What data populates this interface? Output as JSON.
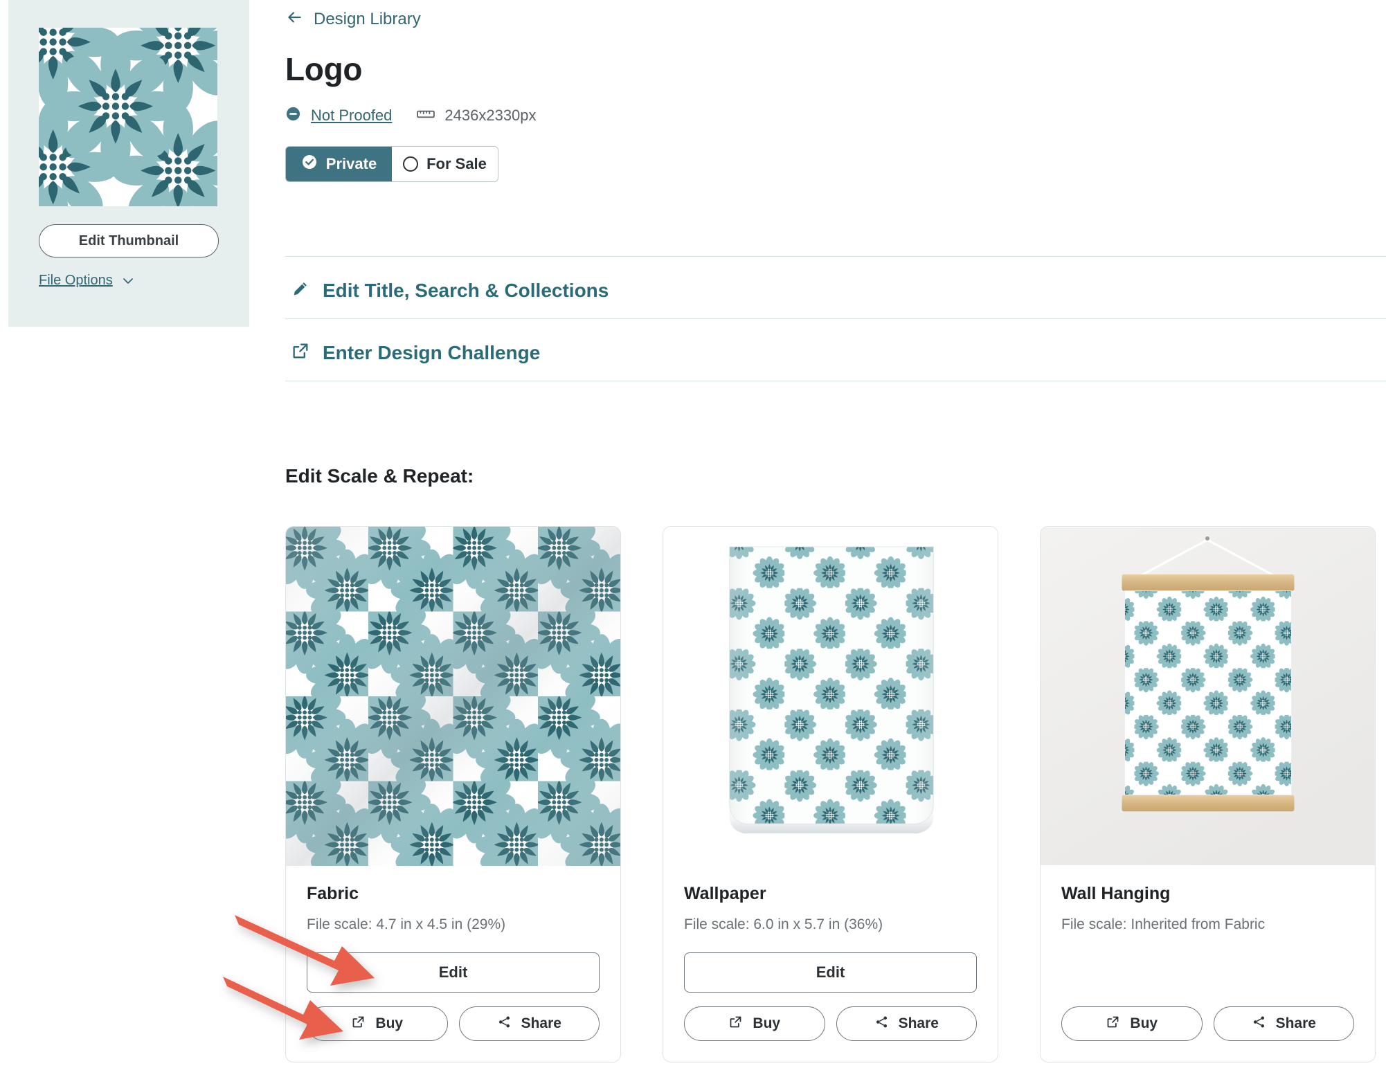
{
  "theme": {
    "teal": "#3f7381",
    "teal_link": "#336672",
    "teal_action": "#2b6b77",
    "sidebar_bg": "#e6eeee",
    "arrow_color": "#e8604c",
    "petal_light": "#8ebdc2",
    "petal_dark": "#2d6670",
    "divider": "#d7e0e3"
  },
  "sidebar": {
    "thumbnail_alt": "floral-pattern-thumbnail",
    "edit_thumbnail_label": "Edit Thumbnail",
    "file_options_label": "File Options",
    "chevron_icon": "chevron-down-icon"
  },
  "header": {
    "back_icon": "arrow-left-icon",
    "breadcrumb_label": "Design Library",
    "title": "Logo",
    "proof_icon": "minus-circle-icon",
    "proof_status": "Not Proofed",
    "ruler_icon": "ruler-icon",
    "dimensions": "2436x2330px",
    "toggle": {
      "private_label": "Private",
      "private_icon": "check-circle-icon",
      "for_sale_label": "For Sale",
      "for_sale_icon": "radio-empty-icon",
      "selected": "Private"
    }
  },
  "actions": [
    {
      "label": "Edit Title, Search & Collections",
      "icon": "pencil-icon"
    },
    {
      "label": "Enter Design Challenge",
      "icon": "external-link-icon"
    }
  ],
  "main": {
    "section_title": "Edit Scale & Repeat:"
  },
  "cards": [
    {
      "title": "Fabric",
      "scale": "File scale:  4.7 in x 4.5 in (29%)",
      "media": "fabric-swatch-image",
      "edit_label": "Edit",
      "has_edit": true,
      "buy_label": "Buy",
      "buy_icon": "external-link-icon",
      "share_label": "Share",
      "share_icon": "share-icon"
    },
    {
      "title": "Wallpaper",
      "scale": "File scale:  6.0 in x 5.7 in (36%)",
      "media": "wallpaper-roll-image",
      "edit_label": "Edit",
      "has_edit": true,
      "buy_label": "Buy",
      "buy_icon": "external-link-icon",
      "share_label": "Share",
      "share_icon": "share-icon"
    },
    {
      "title": "Wall Hanging",
      "scale": "File scale:  Inherited from Fabric",
      "media": "wall-hanging-image",
      "edit_label": "",
      "has_edit": false,
      "buy_label": "Buy",
      "buy_icon": "external-link-icon",
      "share_label": "Share",
      "share_icon": "share-icon"
    }
  ],
  "annotations": [
    {
      "name": "arrow-to-fabric-edit-button",
      "color": "#e8604c"
    },
    {
      "name": "arrow-to-fabric-buy-button",
      "color": "#e8604c"
    }
  ]
}
